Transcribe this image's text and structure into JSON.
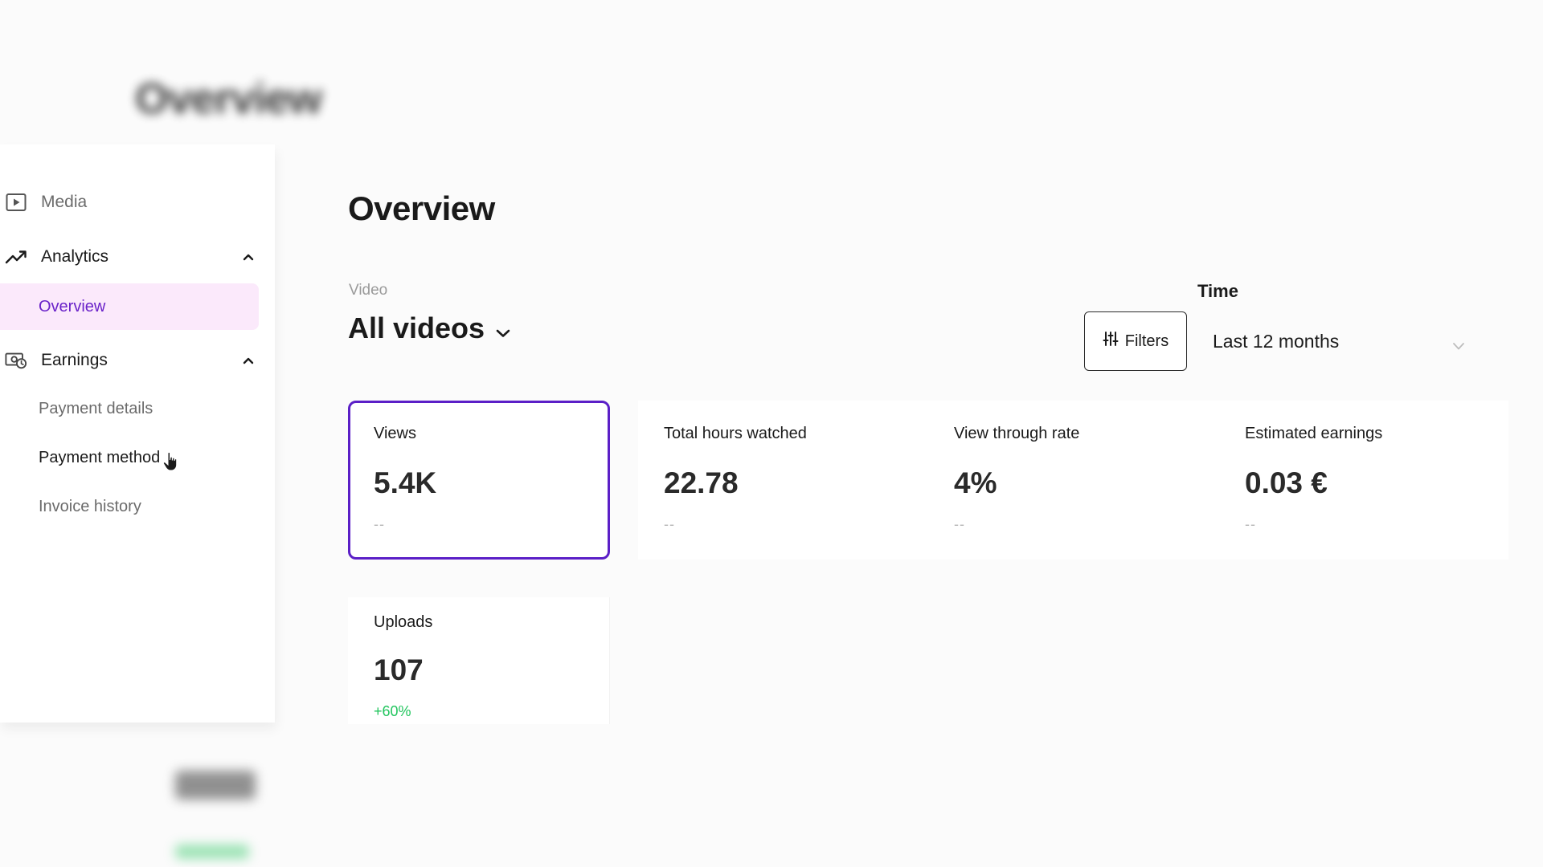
{
  "page": {
    "title": "Overview"
  },
  "sidebar": {
    "media": {
      "label": "Media",
      "icon": "play-square-icon"
    },
    "analytics": {
      "label": "Analytics",
      "icon": "trend-up-icon"
    },
    "analytics_items": [
      {
        "label": "Overview",
        "active": true
      }
    ],
    "earnings": {
      "label": "Earnings",
      "icon": "money-icon"
    },
    "earnings_items": [
      {
        "label": "Payment details"
      },
      {
        "label": "Payment method"
      },
      {
        "label": "Invoice history"
      }
    ]
  },
  "filters": {
    "video_label": "Video",
    "video_value": "All videos",
    "time_label": "Time",
    "filters_button": "Filters",
    "time_value": "Last 12 months"
  },
  "metrics": [
    {
      "label": "Views",
      "value": "5.4K",
      "delta": "--",
      "selected": true
    },
    {
      "label": "Total hours watched",
      "value": "22.78",
      "delta": "--"
    },
    {
      "label": "View through rate",
      "value": "4%",
      "delta": "--"
    },
    {
      "label": "Estimated earnings",
      "value": "0.03 €",
      "delta": "--"
    },
    {
      "label": "Uploads",
      "value": "107",
      "delta": "+60%"
    }
  ],
  "colors": {
    "accent": "#5b1fc7",
    "active_bg": "#fbe9fb",
    "positive": "#22c55e"
  }
}
